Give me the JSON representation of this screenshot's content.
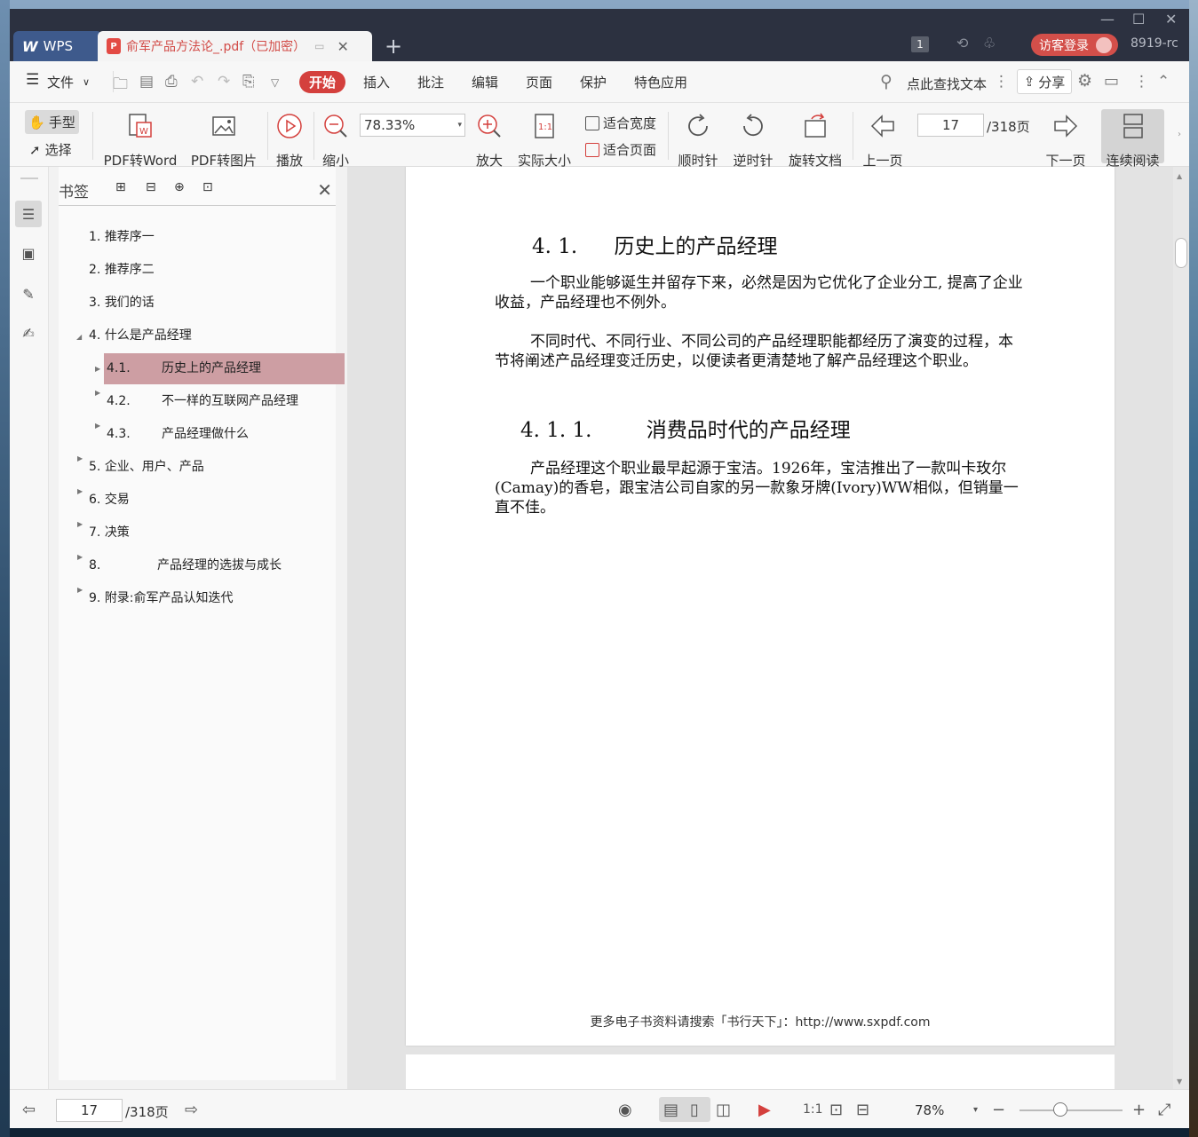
{
  "window": {
    "wps_tab_label": "WPS",
    "doc_tab_title": "俞军产品方法论_.pdf（已加密）",
    "badge_count": "1",
    "login_label": "访客登录",
    "user_id": "8919-rc"
  },
  "menu": {
    "file_label": "文件",
    "start_label": "开始",
    "items": [
      "插入",
      "批注",
      "编辑",
      "页面",
      "保护",
      "特色应用"
    ],
    "search_placeholder": "点此查找文本",
    "share_label": "分享"
  },
  "toolbar": {
    "hand_label": "手型",
    "select_label": "选择",
    "pdf_to_word": "PDF转Word",
    "pdf_to_image": "PDF转图片",
    "play_label": "播放",
    "zoom_out_label": "缩小",
    "zoom_value": "78.33%",
    "zoom_in_label": "放大",
    "actual_size_label": "实际大小",
    "fit_width_label": "适合宽度",
    "fit_page_label": "适合页面",
    "clockwise_label": "顺时针",
    "counter_clockwise_label": "逆时针",
    "rotate_doc_label": "旋转文档",
    "prev_page_label": "上一页",
    "page_current": "17",
    "page_total": "/318页",
    "next_page_label": "下一页",
    "continuous_read_label": "连续阅读"
  },
  "bookmarks": {
    "title": "书签",
    "items": [
      {
        "num": "1.",
        "label": "推荐序一"
      },
      {
        "num": "2.",
        "label": "推荐序二"
      },
      {
        "num": "3.",
        "label": "我们的话"
      },
      {
        "num": "4.",
        "label": "什么是产品经理"
      },
      {
        "num": "4.1.",
        "label": "历史上的产品经理"
      },
      {
        "num": "4.2.",
        "label": "不一样的互联网产品经理"
      },
      {
        "num": "4.3.",
        "label": "产品经理做什么"
      },
      {
        "num": "5.",
        "label": "企业、用户、产品"
      },
      {
        "num": "6.",
        "label": "交易"
      },
      {
        "num": "7.",
        "label": "决策"
      },
      {
        "num": "8.",
        "label": "产品经理的选拔与成长"
      },
      {
        "num": "9.",
        "label": "附录:俞军产品认知迭代"
      }
    ]
  },
  "document": {
    "h1_num": "4. 1.",
    "h1_text": "历史上的产品经理",
    "para1": "一个职业能够诞生并留存下来，必然是因为它优化了企业分工, 提高了企业收益，产品经理也不例外。",
    "para2": "不同时代、不同行业、不同公司的产品经理职能都经历了演变的过程，本节将阐述产品经理变迁历史，以便读者更清楚地了解产品经理这个职业。",
    "h2_num": "4. 1. 1.",
    "h2_text": "消费品时代的产品经理",
    "para3": "产品经理这个职业最早起源于宝洁。1926年，宝洁推出了一款叫卡玫尔(Camay)的香皂，跟宝洁公司自家的另一款象牙牌(Ivory)WW相似，但销量一直不佳。",
    "footer": "更多电子书资料请搜索「书行天下」：http://www.sxpdf.com"
  },
  "status": {
    "page_current": "17",
    "page_total": "/318页",
    "zoom": "78%",
    "zoom_fraction": 0.4
  }
}
